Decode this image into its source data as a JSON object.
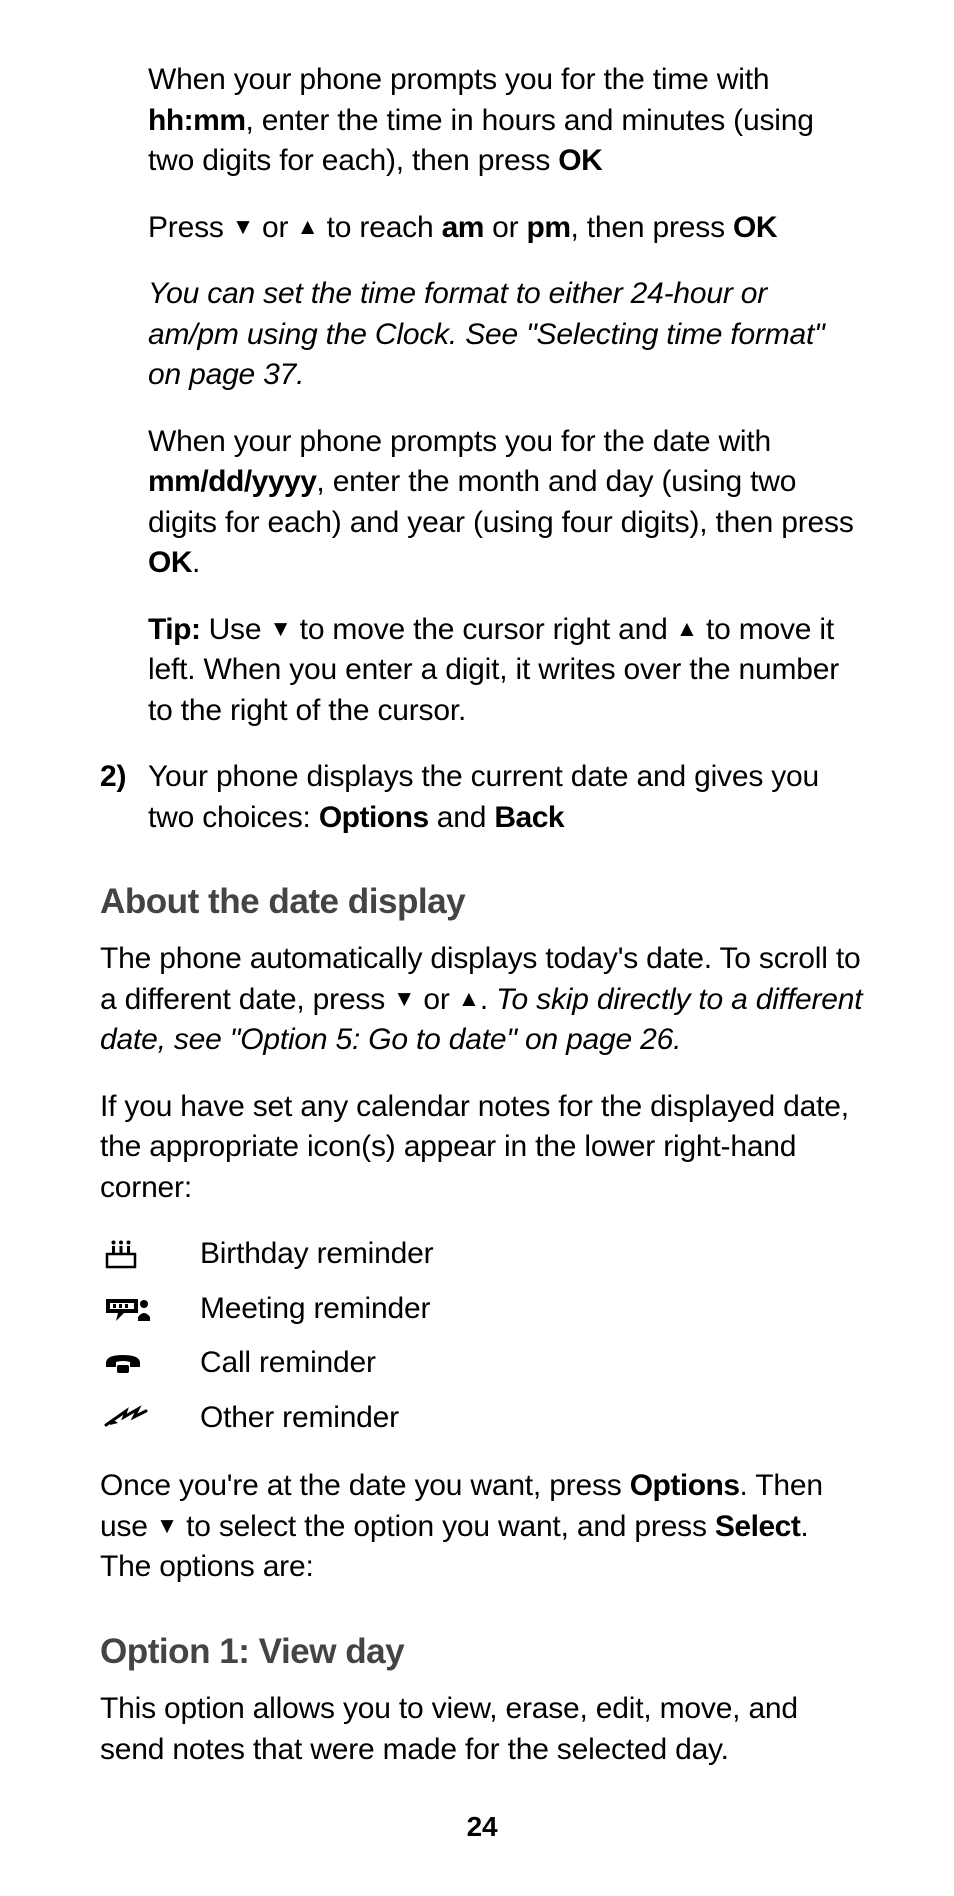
{
  "p1_a": "When your phone prompts you for the time with ",
  "p1_b": "hh:mm",
  "p1_c": ", enter the time in hours and minutes (using two digits for each), then press ",
  "p1_d": "OK",
  "p2_a": "Press ",
  "p2_b": " or ",
  "p2_c": " to reach ",
  "p2_d": "am",
  "p2_e": " or ",
  "p2_f": "pm",
  "p2_g": ", then press ",
  "p2_h": "OK",
  "p3": "You can set the time format to either 24-hour or am/pm using the Clock. See \"Selecting time format\" on page 37.",
  "p4_a": "When your phone prompts you for the date with ",
  "p4_b": "mm/dd/yyyy",
  "p4_c": ", enter the month and day (using two digits for each) and year (using four digits), then press ",
  "p4_d": "OK",
  "p4_e": ".",
  "p5_a": "Tip:",
  "p5_b": " Use ",
  "p5_c": " to move the cursor right and ",
  "p5_d": " to move it left. When you enter a digit, it writes over the number to the right of the cursor.",
  "step_num": "2)",
  "p6_a": "Your phone displays the current date and gives you two choices: ",
  "p6_b": "Options",
  "p6_c": " and ",
  "p6_d": "Back",
  "h1": "About the date display",
  "p7_a": "The phone automatically displays today's date. To scroll to a different date, press ",
  "p7_b": " or ",
  "p7_c": ". ",
  "p7_d": "To skip directly to a different date, see \"Option 5: Go to date\" on page 26.",
  "p8": "If you have set any calendar notes for the displayed date, the appropriate icon(s) appear in the lower right-hand corner:",
  "icons": {
    "birthday": "Birthday reminder",
    "meeting": "Meeting reminder",
    "call": "Call reminder",
    "other": "Other reminder"
  },
  "p9_a": "Once you're at the date you want, press ",
  "p9_b": "Options",
  "p9_c": ". Then use ",
  "p9_d": " to select the option you want, and press ",
  "p9_e": "Select",
  "p9_f": ". The options are:",
  "h2": "Option 1: View day",
  "p10": "This option allows you to view, erase, edit, move, and send notes that were made for the selected day.",
  "page": "24"
}
